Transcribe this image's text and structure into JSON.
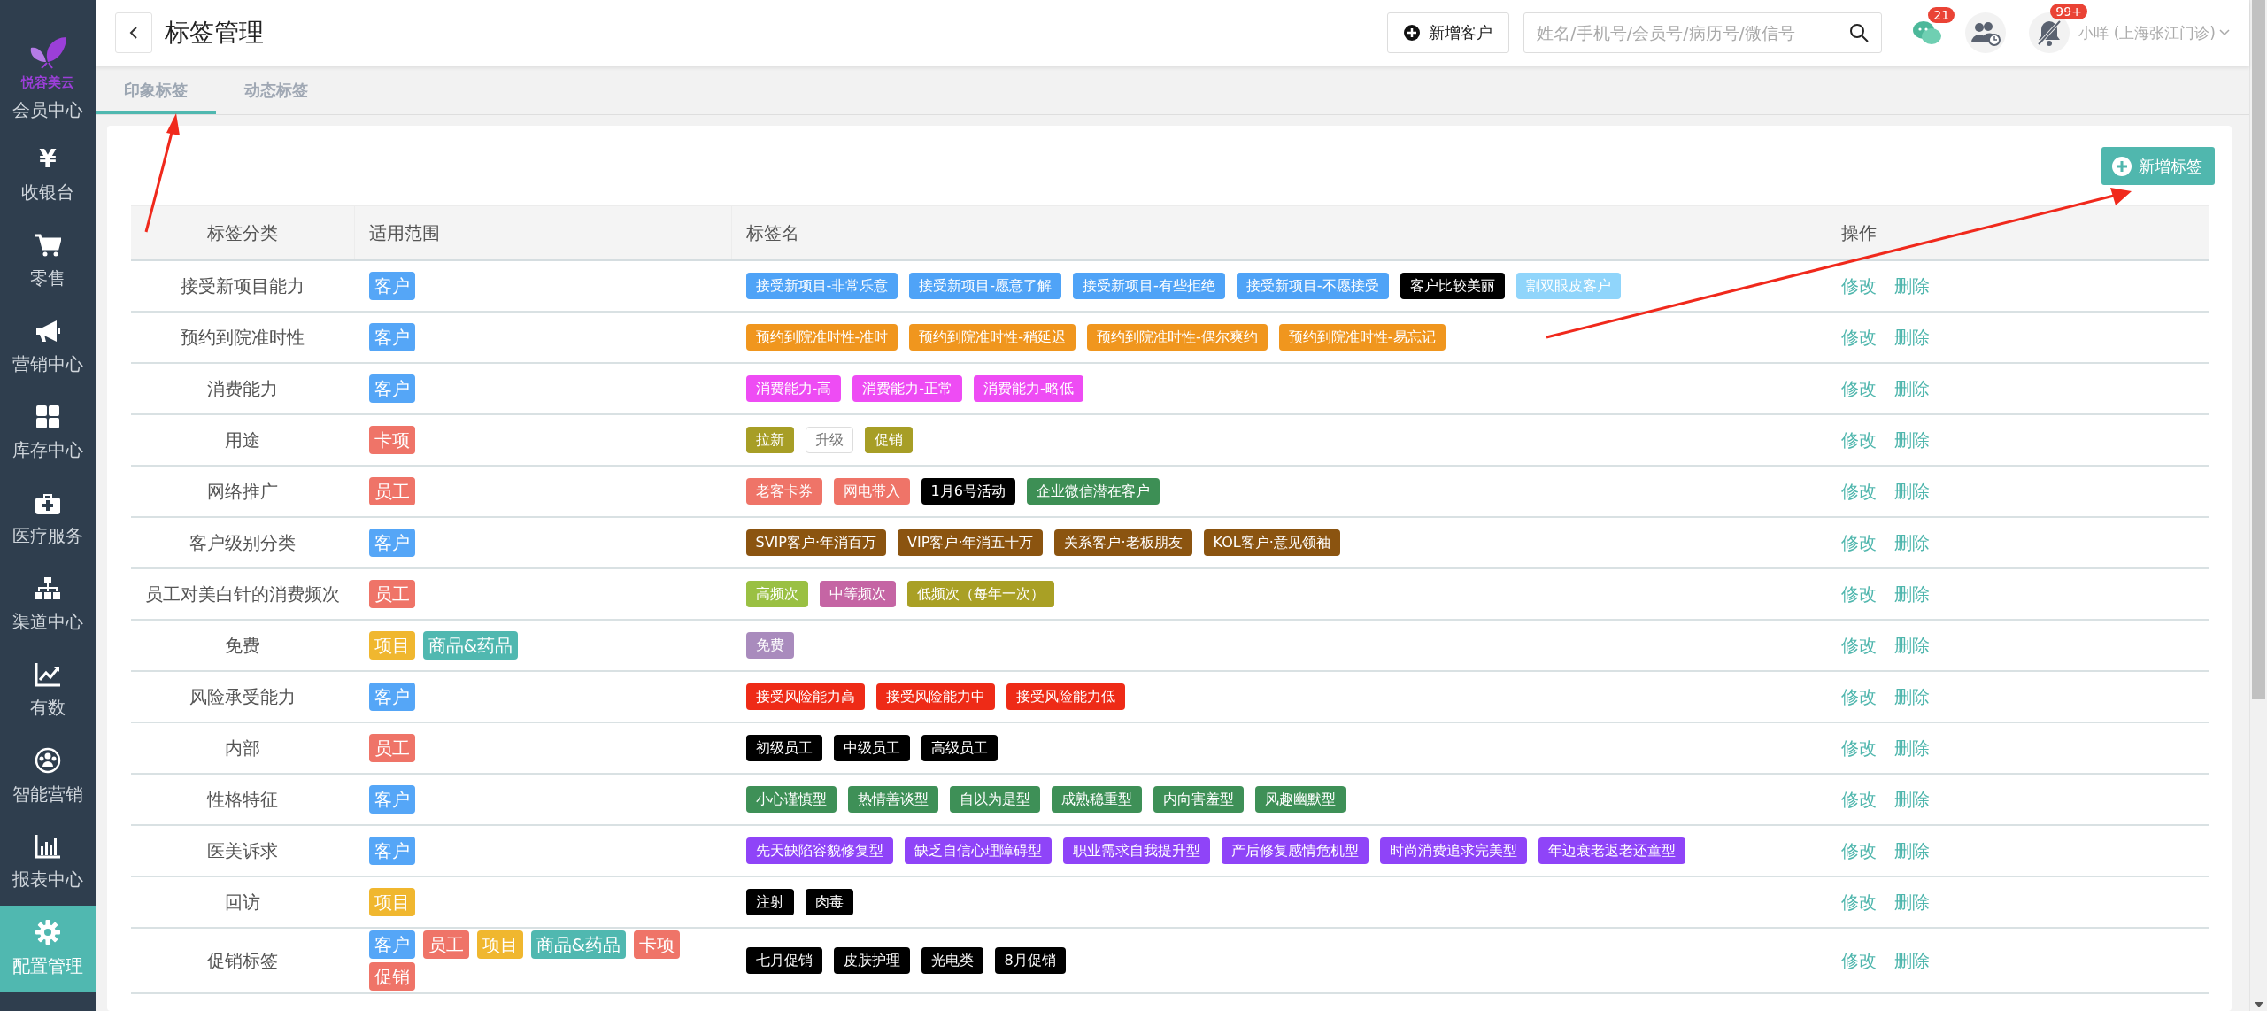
{
  "brand": {
    "name": "悦容美云"
  },
  "sidebar": {
    "items": [
      {
        "label": "会员中心",
        "selected": false
      },
      {
        "label": "收银台",
        "selected": false,
        "glyph": "¥"
      },
      {
        "label": "零售",
        "selected": false
      },
      {
        "label": "营销中心",
        "selected": false
      },
      {
        "label": "库存中心",
        "selected": false
      },
      {
        "label": "医疗服务",
        "selected": false
      },
      {
        "label": "渠道中心",
        "selected": false
      },
      {
        "label": "有数",
        "selected": false
      },
      {
        "label": "智能营销",
        "selected": false
      },
      {
        "label": "报表中心",
        "selected": false
      },
      {
        "label": "配置管理",
        "selected": true
      }
    ]
  },
  "header": {
    "title": "标签管理",
    "new_customer_button": "新增客户",
    "search": {
      "placeholder": "姓名/手机号/会员号/病历号/微信号"
    },
    "chat_badge": "21",
    "notification_badge": "99+",
    "user": "小咩 (上海张江门诊)"
  },
  "tabs": [
    {
      "label": "印象标签",
      "selected": true
    },
    {
      "label": "动态标签",
      "selected": false
    }
  ],
  "add_tag_button": "新增标签",
  "table": {
    "columns": [
      "标签分类",
      "适用范围",
      "标签名",
      "操作"
    ],
    "rows": [
      {
        "category": "接受新项目能力",
        "scopes": [
          {
            "label": "客户",
            "color": "#55a6f7"
          }
        ],
        "tags": [
          {
            "label": "接受新项目-非常乐意",
            "color": "#4fa3f7"
          },
          {
            "label": "接受新项目-愿意了解",
            "color": "#4fa3f7"
          },
          {
            "label": "接受新项目-有些拒绝",
            "color": "#4fa3f7"
          },
          {
            "label": "接受新项目-不愿接受",
            "color": "#4fa3f7"
          },
          {
            "label": "客户比较美丽",
            "color": "#000000"
          },
          {
            "label": "割双眼皮客户",
            "color": "#90d5fb"
          }
        ],
        "actions": [
          "修改",
          "删除"
        ]
      },
      {
        "category": "预约到院准时性",
        "scopes": [
          {
            "label": "客户",
            "color": "#55a6f7"
          }
        ],
        "tags": [
          {
            "label": "预约到院准时性-准时",
            "color": "#f0961e"
          },
          {
            "label": "预约到院准时性-稍延迟",
            "color": "#f0961e"
          },
          {
            "label": "预约到院准时性-偶尔爽约",
            "color": "#f0961e"
          },
          {
            "label": "预约到院准时性-易忘记",
            "color": "#f0961e"
          }
        ],
        "actions": [
          "修改",
          "删除"
        ]
      },
      {
        "category": "消费能力",
        "scopes": [
          {
            "label": "客户",
            "color": "#55a6f7"
          }
        ],
        "tags": [
          {
            "label": "消费能力-高",
            "color": "#ee4cf4"
          },
          {
            "label": "消费能力-正常",
            "color": "#ee4cf4"
          },
          {
            "label": "消费能力-略低",
            "color": "#ee4cf4"
          }
        ],
        "actions": [
          "修改",
          "删除"
        ]
      },
      {
        "category": "用途",
        "scopes": [
          {
            "label": "卡项",
            "color": "#ef7468"
          }
        ],
        "tags": [
          {
            "label": "拉新",
            "color": "#a79e26"
          },
          {
            "label": "升级",
            "color": "#ffffff"
          },
          {
            "label": "促销",
            "color": "#a79e26"
          }
        ],
        "actions": [
          "修改",
          "删除"
        ]
      },
      {
        "category": "网络推广",
        "scopes": [
          {
            "label": "员工",
            "color": "#ef7468"
          }
        ],
        "tags": [
          {
            "label": "老客卡券",
            "color": "#ef7468"
          },
          {
            "label": "网电带入",
            "color": "#ef7468"
          },
          {
            "label": "1月6号活动",
            "color": "#000000"
          },
          {
            "label": "企业微信潜在客户",
            "color": "#3d8f55"
          }
        ],
        "actions": [
          "修改",
          "删除"
        ]
      },
      {
        "category": "客户级别分类",
        "scopes": [
          {
            "label": "客户",
            "color": "#55a6f7"
          }
        ],
        "tags": [
          {
            "label": "SVIP客户·年消百万",
            "color": "#8b5410"
          },
          {
            "label": "VIP客户·年消五十万",
            "color": "#8b5410"
          },
          {
            "label": "关系客户·老板朋友",
            "color": "#8b5410"
          },
          {
            "label": "KOL客户·意见领袖",
            "color": "#8b5410"
          }
        ],
        "actions": [
          "修改",
          "删除"
        ]
      },
      {
        "category": "员工对美白针的消费频次",
        "scopes": [
          {
            "label": "员工",
            "color": "#ef7468"
          }
        ],
        "tags": [
          {
            "label": "高频次",
            "color": "#9ac043"
          },
          {
            "label": "中等频次",
            "color": "#c565a4"
          },
          {
            "label": "低频次（每年一次）",
            "color": "#a9a025"
          }
        ],
        "actions": [
          "修改",
          "删除"
        ]
      },
      {
        "category": "免费",
        "scopes": [
          {
            "label": "项目",
            "color": "#f0b72f"
          },
          {
            "label": "商品&药品",
            "color": "#50b8b0"
          }
        ],
        "tags": [
          {
            "label": "免费",
            "color": "#a98bbd"
          }
        ],
        "actions": [
          "修改",
          "删除"
        ]
      },
      {
        "category": "风险承受能力",
        "scopes": [
          {
            "label": "客户",
            "color": "#55a6f7"
          }
        ],
        "tags": [
          {
            "label": "接受风险能力高",
            "color": "#ee2b17"
          },
          {
            "label": "接受风险能力中",
            "color": "#ee2b17"
          },
          {
            "label": "接受风险能力低",
            "color": "#ee2b17"
          }
        ],
        "actions": [
          "修改",
          "删除"
        ]
      },
      {
        "category": "内部",
        "scopes": [
          {
            "label": "员工",
            "color": "#ef7468"
          }
        ],
        "tags": [
          {
            "label": "初级员工",
            "color": "#000000"
          },
          {
            "label": "中级员工",
            "color": "#000000"
          },
          {
            "label": "高级员工",
            "color": "#000000"
          }
        ],
        "actions": [
          "修改",
          "删除"
        ]
      },
      {
        "category": "性格特征",
        "scopes": [
          {
            "label": "客户",
            "color": "#55a6f7"
          }
        ],
        "tags": [
          {
            "label": "小心谨慎型",
            "color": "#3e9057"
          },
          {
            "label": "热情善谈型",
            "color": "#3e9057"
          },
          {
            "label": "自以为是型",
            "color": "#3e9057"
          },
          {
            "label": "成熟稳重型",
            "color": "#3e9057"
          },
          {
            "label": "内向害羞型",
            "color": "#3e9057"
          },
          {
            "label": "风趣幽默型",
            "color": "#3e9057"
          }
        ],
        "actions": [
          "修改",
          "删除"
        ]
      },
      {
        "category": "医美诉求",
        "scopes": [
          {
            "label": "客户",
            "color": "#55a6f7"
          }
        ],
        "tags": [
          {
            "label": "先天缺陷容貌修复型",
            "color": "#8f44f8"
          },
          {
            "label": "缺乏自信心理障碍型",
            "color": "#8f44f8"
          },
          {
            "label": "职业需求自我提升型",
            "color": "#8f44f8"
          },
          {
            "label": "产后修复感情危机型",
            "color": "#8f44f8"
          },
          {
            "label": "时尚消费追求完美型",
            "color": "#8f44f8"
          },
          {
            "label": "年迈衰老返老还童型",
            "color": "#8f44f8"
          }
        ],
        "actions": [
          "修改",
          "删除"
        ]
      },
      {
        "category": "回访",
        "scopes": [
          {
            "label": "项目",
            "color": "#f0b72f"
          }
        ],
        "tags": [
          {
            "label": "注射",
            "color": "#000000"
          },
          {
            "label": "肉毒",
            "color": "#000000"
          }
        ],
        "actions": [
          "修改",
          "删除"
        ]
      },
      {
        "category": "促销标签",
        "scopes": [
          {
            "label": "客户",
            "color": "#55a6f7"
          },
          {
            "label": "员工",
            "color": "#ef7468"
          },
          {
            "label": "项目",
            "color": "#f0b72f"
          },
          {
            "label": "商品&药品",
            "color": "#50b8b0"
          },
          {
            "label": "卡项",
            "color": "#ef7468"
          },
          {
            "label": "促销",
            "color": "#ef7468"
          }
        ],
        "tags": [
          {
            "label": "七月促销",
            "color": "#000000"
          },
          {
            "label": "皮肤护理",
            "color": "#000000"
          },
          {
            "label": "光电类",
            "color": "#000000"
          },
          {
            "label": "8月促销",
            "color": "#000000"
          }
        ],
        "actions": [
          "修改",
          "删除"
        ]
      }
    ]
  }
}
